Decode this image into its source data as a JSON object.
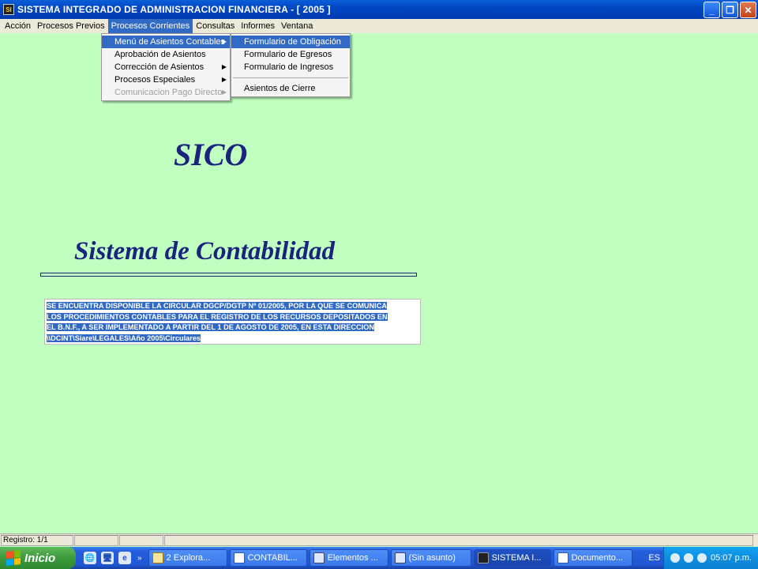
{
  "window": {
    "title": "SISTEMA INTEGRADO DE ADMINISTRACION FINANCIERA - [ 2005 ]",
    "app_icon_text": "SI",
    "min_glyph": "_",
    "max_glyph": "❐",
    "close_glyph": "✕"
  },
  "menubar": [
    "Acción",
    "Procesos Previos",
    "Procesos Corrientes",
    "Consultas",
    "Informes",
    "Ventana"
  ],
  "dropdown_main": [
    {
      "label": "Menú de Asientos Contables",
      "submenu": true
    },
    {
      "label": "Aprobación de Asientos",
      "submenu": false
    },
    {
      "label": "Corrección de Asientos",
      "submenu": true
    },
    {
      "label": "Procesos Especiales",
      "submenu": true
    },
    {
      "label": "Comunicacion Pago Directo",
      "submenu": true
    }
  ],
  "dropdown_sub": [
    "Formulario de Obligación",
    "Formulario de Egresos",
    "Formulario de Ingresos",
    "Asientos de Cierre"
  ],
  "arrow_glyph": "▶",
  "content": {
    "logo": "SICO",
    "subtitle": "Sistema de Contabilidad",
    "notice": [
      "SE ENCUENTRA DISPONIBLE LA CIRCULAR DGCP/DGTP Nº 01/2005, POR LA QUE SE COMUNICA",
      "LOS PROCEDIMIENTOS CONTABLES PARA EL REGISTRO DE LOS RECURSOS DEPOSITADOS EN",
      "EL B.N.F., A SER IMPLEMENTADO A PARTIR DEL 1 DE AGOSTO DE 2005, EN ESTA DIRECCION",
      "\\\\DCINT\\Siare\\LEGALES\\Año 2005\\Circulares"
    ]
  },
  "statusbar": {
    "record": "Registro: 1/1"
  },
  "taskbar": {
    "start": "Inicio",
    "chevron": "»",
    "quick_launch": [
      "🌐",
      "🖥",
      "e"
    ],
    "buttons": [
      "2 Explora...",
      "CONTABIL...",
      "Elementos ...",
      "(Sin asunto)",
      "SISTEMA I...",
      "Documento..."
    ],
    "lang": "ES",
    "clock": "05:07 p.m."
  },
  "colors": {
    "accent": "#316ac5",
    "background": "#c0ffc0",
    "title_text": "#1a237e"
  }
}
